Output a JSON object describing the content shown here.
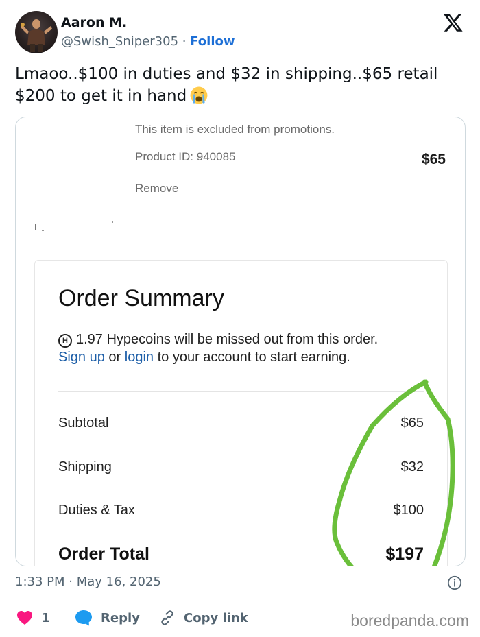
{
  "author": {
    "name": "Aaron M.",
    "handle": "@Swish_Sniper305",
    "separator": "·",
    "follow_label": "Follow"
  },
  "tweet": {
    "text": "Lmaoo..$100 in duties and $32 in shipping..$65 retail $200 to get it in hand",
    "emoji": "crying-face-emoji"
  },
  "screenshot": {
    "excluded_note": "This item is excluded from promotions.",
    "product_id": "Product ID: 940085",
    "item_price": "$65",
    "remove_label": "Remove",
    "order_summary": {
      "title": "Order Summary",
      "hypecoins_symbol": "H",
      "hypecoins_text": "1.97 Hypecoins will be missed out from this order.",
      "signup_label": "Sign up",
      "or_text": "or",
      "login_label": "login",
      "earning_text": "to your account to start earning.",
      "rows": [
        {
          "label": "Subtotal",
          "value": "$65"
        },
        {
          "label": "Shipping",
          "value": "$32"
        },
        {
          "label": "Duties & Tax",
          "value": "$100"
        }
      ],
      "total_label": "Order Total",
      "total_value": "$197"
    },
    "annotation_color": "#6abf3a"
  },
  "meta": {
    "time": "1:33 PM",
    "separator": "·",
    "date": "May 16, 2025"
  },
  "actions": {
    "like_count": "1",
    "reply_label": "Reply",
    "copy_link_label": "Copy link"
  },
  "watermark": "boredpanda.com",
  "colors": {
    "accent_blue": "#1d6fd6",
    "like_pink": "#f91880",
    "reply_blue": "#1d9bf0",
    "secondary_text": "#536471"
  }
}
